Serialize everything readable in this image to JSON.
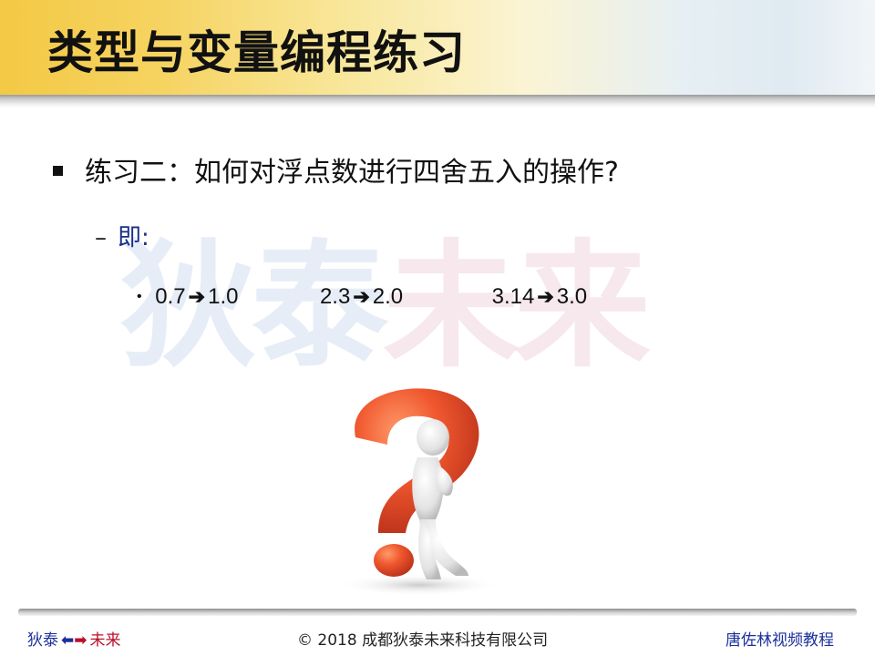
{
  "title": "类型与变量编程练习",
  "watermark": {
    "part1": "狄泰",
    "part2": "未来"
  },
  "bullet_level1": "练习二：如何对浮点数进行四舍五入的操作?",
  "bullet_level2": "即:",
  "examples": [
    {
      "from": "0.7",
      "to": "1.0"
    },
    {
      "from": "2.3",
      "to": "2.0"
    },
    {
      "from": "3.14",
      "to": "3.0"
    }
  ],
  "footer": {
    "left_a": "狄泰",
    "left_b": "未来",
    "center": "© 2018 成都狄泰未来科技有限公司",
    "right": "唐佐林视频教程"
  },
  "colors": {
    "accent_blue": "#1a2f9a",
    "accent_red": "#b8102a",
    "question_mark": "#e8502a"
  }
}
